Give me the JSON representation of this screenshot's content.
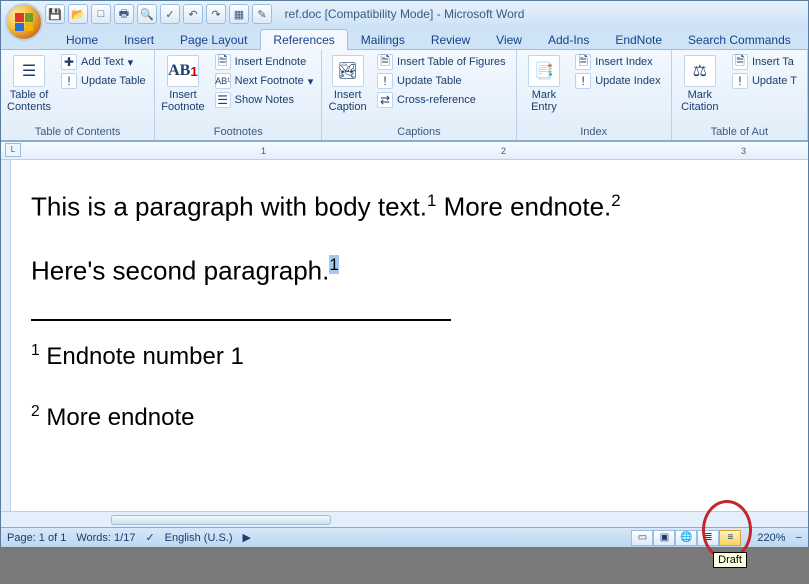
{
  "title": "ref.doc [Compatibility Mode] - Microsoft Word",
  "qat": [
    "save-icon",
    "open-icon",
    "new-icon",
    "print-icon",
    "preview-icon",
    "spell-icon",
    "undo-icon",
    "redo-icon",
    "table-icon",
    "format-icon"
  ],
  "tabs": [
    {
      "label": "Home"
    },
    {
      "label": "Insert"
    },
    {
      "label": "Page Layout"
    },
    {
      "label": "References",
      "active": true
    },
    {
      "label": "Mailings"
    },
    {
      "label": "Review"
    },
    {
      "label": "View"
    },
    {
      "label": "Add-Ins"
    },
    {
      "label": "EndNote"
    },
    {
      "label": "Search Commands"
    }
  ],
  "ribbon": {
    "toc": {
      "big": "Table of\nContents",
      "add_text": "Add Text",
      "update": "Update Table",
      "label": "Table of Contents"
    },
    "footnotes": {
      "big": "Insert\nFootnote",
      "big_badge": "AB¹",
      "insert_endnote": "Insert Endnote",
      "next_footnote": "Next Footnote",
      "show_notes": "Show Notes",
      "label": "Footnotes"
    },
    "captions": {
      "big": "Insert\nCaption",
      "insert_tof": "Insert Table of Figures",
      "update": "Update Table",
      "cross_ref": "Cross-reference",
      "label": "Captions"
    },
    "index": {
      "big": "Mark\nEntry",
      "insert_index": "Insert Index",
      "update_index": "Update Index",
      "label": "Index"
    },
    "toa": {
      "big": "Mark\nCitation",
      "insert_toa": "Insert Ta",
      "update_toa": "Update T",
      "label": "Table of Aut"
    }
  },
  "ruler_marks": [
    "1",
    "2",
    "3"
  ],
  "document": {
    "p1_a": "This is a paragraph with body text.",
    "p1_sup1": "1",
    "p1_b": "  More endnote.",
    "p1_sup2": "2",
    "p2_a": "Here's second paragraph.",
    "p2_sup": "1",
    "en1_sup": "1",
    "en1": " Endnote number 1",
    "en2_sup": "2",
    "en2": " More endnote"
  },
  "status": {
    "page": "Page: 1 of 1",
    "words": "Words: 1/17",
    "lang": "English (U.S.)",
    "zoom": "220%"
  },
  "tooltip": "Draft"
}
